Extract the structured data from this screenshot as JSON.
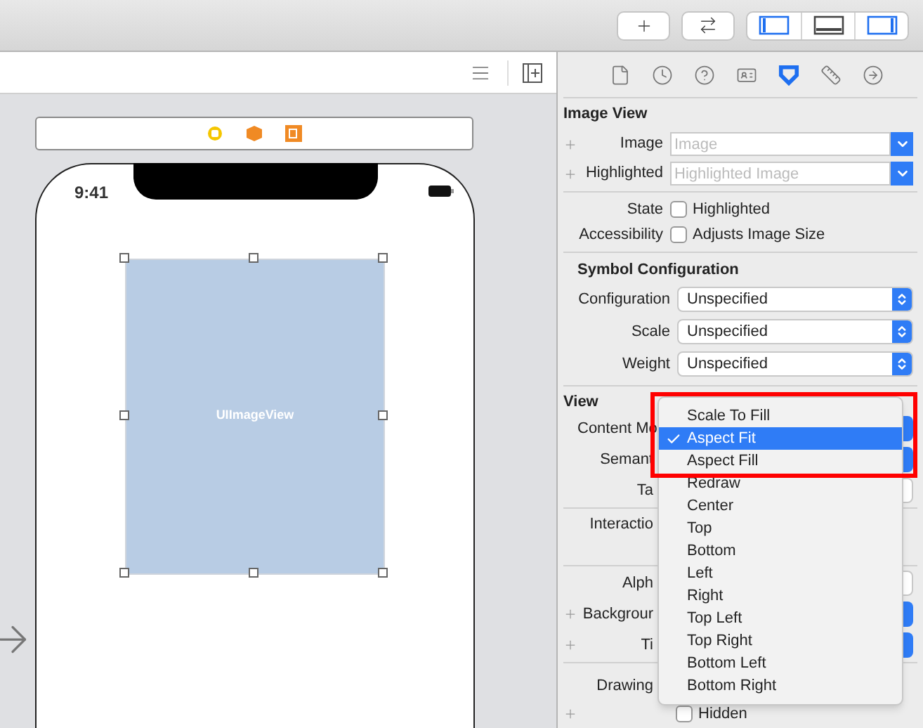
{
  "toolbar": {
    "panel_toggles": [
      {
        "selected": true
      },
      {
        "selected": false
      },
      {
        "selected": true
      }
    ]
  },
  "canvas": {
    "status_time": "9:41",
    "view_label": "UIImageView"
  },
  "inspector": {
    "tabs": [
      {
        "selected": false
      },
      {
        "selected": false
      },
      {
        "selected": false
      },
      {
        "selected": false
      },
      {
        "selected": true
      },
      {
        "selected": false
      },
      {
        "selected": false
      }
    ],
    "image_view": {
      "title": "Image View",
      "fields": [
        {
          "label": "Image",
          "placeholder": "Image"
        },
        {
          "label": "Highlighted",
          "placeholder": "Highlighted Image"
        }
      ],
      "checks": [
        {
          "label": "State",
          "option": "Highlighted",
          "checked": false
        },
        {
          "label": "Accessibility",
          "option": "Adjusts Image Size",
          "checked": false
        }
      ]
    },
    "symbol_configuration": {
      "title": "Symbol Configuration",
      "popups": [
        {
          "label": "Configuration",
          "value": "Unspecified"
        },
        {
          "label": "Scale",
          "value": "Unspecified"
        },
        {
          "label": "Weight",
          "value": "Unspecified"
        }
      ]
    },
    "view": {
      "title": "View",
      "groups": [
        [
          {
            "label": "Content Mo",
            "kind": "popup",
            "plus": false
          },
          {
            "label": "Semant",
            "kind": "popup",
            "plus": false
          },
          {
            "label": "Ta",
            "kind": "stepper",
            "plus": false
          }
        ],
        [
          {
            "label": "Interactio",
            "kind": "label",
            "plus": false
          }
        ],
        [
          {
            "label": "Alph",
            "kind": "stepper",
            "plus": false
          },
          {
            "label": "Backgrour",
            "kind": "popup",
            "plus": true
          },
          {
            "label": "Ti",
            "kind": "popup",
            "plus": true
          }
        ],
        [
          {
            "label": "Drawing",
            "kind": "short",
            "plus": false
          },
          {
            "kind": "check",
            "plus": true,
            "checked": false,
            "option": "Hidden"
          }
        ]
      ]
    }
  },
  "menu": {
    "items": [
      {
        "label": "Scale To Fill",
        "selected": false
      },
      {
        "label": "Aspect Fit",
        "selected": true
      },
      {
        "label": "Aspect Fill",
        "selected": false
      },
      {
        "label": "Redraw",
        "selected": false
      },
      {
        "label": "Center",
        "selected": false
      },
      {
        "label": "Top",
        "selected": false
      },
      {
        "label": "Bottom",
        "selected": false
      },
      {
        "label": "Left",
        "selected": false
      },
      {
        "label": "Right",
        "selected": false
      },
      {
        "label": "Top Left",
        "selected": false
      },
      {
        "label": "Top Right",
        "selected": false
      },
      {
        "label": "Bottom Left",
        "selected": false
      },
      {
        "label": "Bottom Right",
        "selected": false
      }
    ]
  }
}
